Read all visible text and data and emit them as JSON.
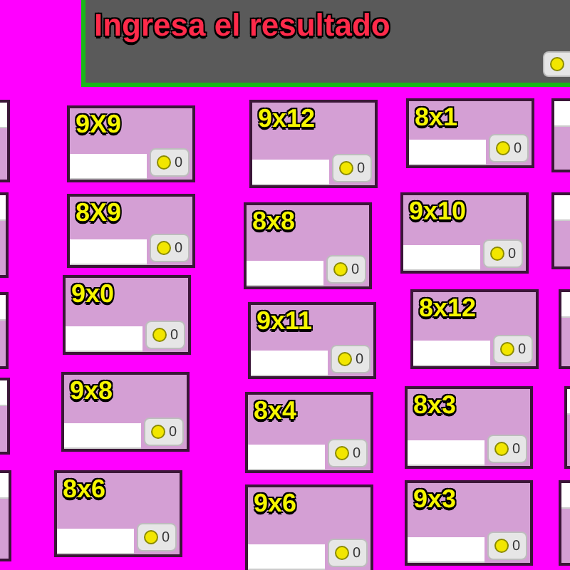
{
  "header": {
    "title": "Ingresa el resultado"
  },
  "cards": [
    {
      "label": "9X9",
      "score": "0"
    },
    {
      "label": "9x12",
      "score": "0"
    },
    {
      "label": "8x1",
      "score": "0"
    },
    {
      "label": "8X9",
      "score": "0"
    },
    {
      "label": "8x8",
      "score": "0"
    },
    {
      "label": "9x10",
      "score": "0"
    },
    {
      "label": "9x0",
      "score": "0"
    },
    {
      "label": "9x11",
      "score": "0"
    },
    {
      "label": "8x12",
      "score": "0"
    },
    {
      "label": "9x8",
      "score": "0"
    },
    {
      "label": "8x4",
      "score": "0"
    },
    {
      "label": "8x3",
      "score": "0"
    },
    {
      "label": "8x6",
      "score": "0"
    },
    {
      "label": "9x6",
      "score": "0"
    },
    {
      "label": "9x3",
      "score": "0"
    },
    {
      "kind": "partial"
    },
    {
      "kind": "partial"
    },
    {
      "kind": "partial"
    },
    {
      "kind": "partial"
    },
    {
      "kind": "partial"
    },
    {
      "kind": "partial"
    },
    {
      "kind": "partial"
    },
    {
      "kind": "partial"
    },
    {
      "kind": "partial"
    },
    {
      "kind": "partial"
    }
  ]
}
